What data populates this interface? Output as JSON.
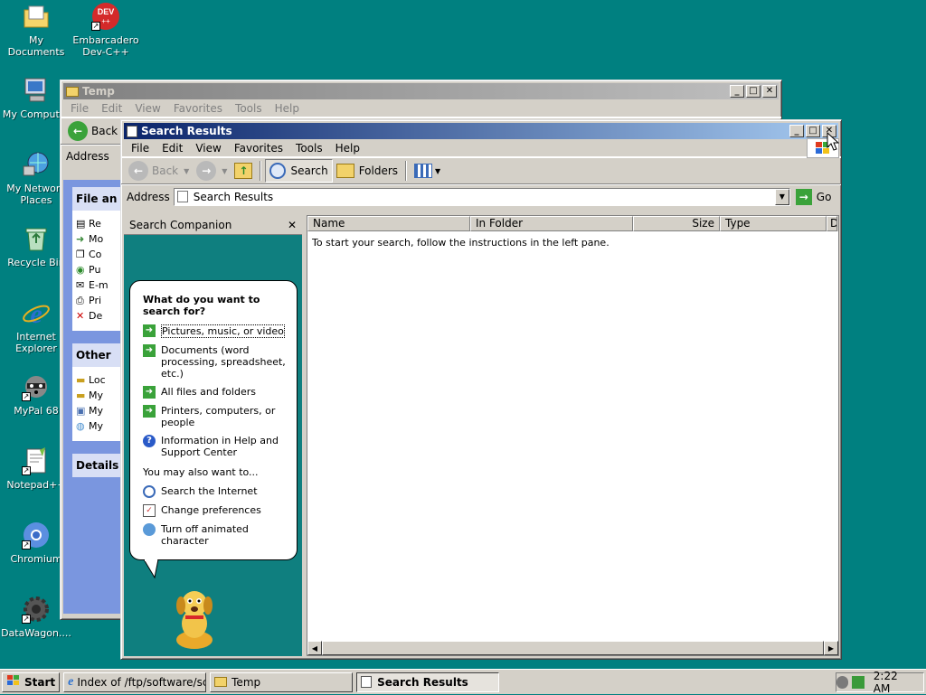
{
  "desktop": {
    "icons": [
      {
        "label": "My Documents"
      },
      {
        "label": "Embarcadero Dev-C++"
      },
      {
        "label": "My Computer"
      },
      {
        "label": "My Network Places"
      },
      {
        "label": "Recycle Bin"
      },
      {
        "label": "Internet Explorer"
      },
      {
        "label": "MyPal 68"
      },
      {
        "label": "Notepad++"
      },
      {
        "label": "Chromium"
      },
      {
        "label": "DataWagon...."
      }
    ],
    "dev_badge": "DEV\n++"
  },
  "temp_window": {
    "title": "Temp",
    "menu": [
      "File",
      "Edit",
      "View",
      "Favorites",
      "Tools",
      "Help"
    ],
    "back_label": "Back",
    "address_label": "Address",
    "tasks_header": "File an",
    "tasks": [
      "Re",
      "Mo",
      "Co",
      "Pu",
      "E-m",
      "Pri",
      "De"
    ],
    "other_header": "Other",
    "other": [
      "Loc",
      "My",
      "My",
      "My"
    ],
    "details_header": "Details"
  },
  "search_window": {
    "title": "Search Results",
    "menu": [
      "File",
      "Edit",
      "View",
      "Favorites",
      "Tools",
      "Help"
    ],
    "toolbar": {
      "back": "Back",
      "search": "Search",
      "folders": "Folders"
    },
    "address_label": "Address",
    "address_value": "Search Results",
    "go_label": "Go",
    "companion_title": "Search Companion",
    "columns": [
      "Name",
      "In Folder",
      "Size",
      "Type",
      "D"
    ],
    "empty_message": "To start your search, follow the instructions in the left pane.",
    "bubble": {
      "question": "What do you want to search for?",
      "options": [
        "Pictures, music, or video",
        "Documents (word processing, spreadsheet, etc.)",
        "All files and folders",
        "Printers, computers, or people",
        "Information in Help and Support Center"
      ],
      "also_label": "You may also want to...",
      "also": [
        "Search the Internet",
        "Change preferences",
        "Turn off animated character"
      ]
    }
  },
  "taskbar": {
    "start": "Start",
    "tasks": [
      "Index of /ftp/software/scr...",
      "Temp",
      "Search Results"
    ],
    "clock": "2:22 AM"
  },
  "colors": {
    "desktop": "#008080",
    "title_active": "#0a246a",
    "companion_bg": "#0f7f7f"
  }
}
